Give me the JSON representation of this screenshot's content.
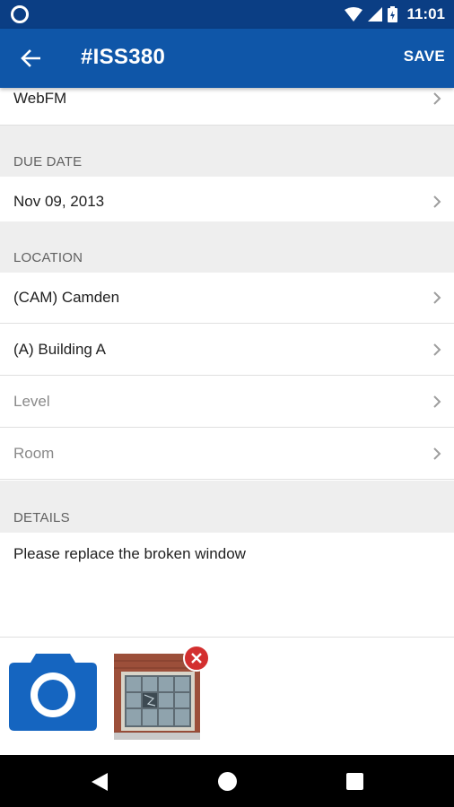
{
  "status_bar": {
    "time": "11:01"
  },
  "app_bar": {
    "title": "#ISS380",
    "save_label": "SAVE"
  },
  "rows": {
    "source": "WebFM",
    "due_date": "Nov 09, 2013",
    "site": "(CAM) Camden",
    "building": "(A) Building A",
    "level": "Level",
    "room": "Room"
  },
  "sections": {
    "due_date": "DUE DATE",
    "location": "LOCATION",
    "details": "DETAILS"
  },
  "details": {
    "text": "Please replace the broken window"
  },
  "colors": {
    "status_bar": "#0b3e84",
    "app_bar": "#0f56a8",
    "accent": "#1565c0",
    "remove": "#d32f2f"
  },
  "icons": [
    "back-arrow-icon",
    "chevron-right-icon",
    "camera-icon",
    "close-icon",
    "wifi-icon",
    "signal-icon",
    "battery-icon"
  ]
}
